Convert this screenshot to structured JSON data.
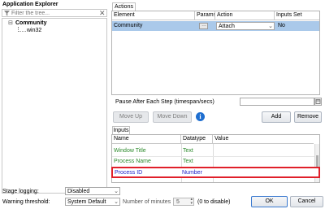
{
  "explorer": {
    "title": "Application Explorer",
    "filter_placeholder": "Filter the tree...",
    "tree_root": "Community",
    "tree_child": "win32",
    "tree_toggle": "⊟"
  },
  "actions": {
    "tab_label": "Actions",
    "columns": [
      "Element",
      "Params",
      "Action",
      "Inputs Set"
    ],
    "row": {
      "element": "Community",
      "action": "Attach",
      "inputs_set": "No"
    }
  },
  "pause": {
    "label": "Pause After Each Step (timespan/secs)",
    "value": ""
  },
  "buttons": {
    "move_up": "Move Up",
    "move_down": "Move Down",
    "add": "Add",
    "remove": "Remove",
    "ok": "OK",
    "cancel": "Cancel"
  },
  "inputs": {
    "tab_label": "Inputs",
    "columns": [
      "Name",
      "Datatype",
      "Value"
    ],
    "rows": [
      {
        "name": "Window Title",
        "datatype": "Text",
        "value": ""
      },
      {
        "name": "Process Name",
        "datatype": "Text",
        "value": ""
      },
      {
        "name": "Process ID",
        "datatype": "Number",
        "value": ""
      }
    ]
  },
  "footer": {
    "stage_logging_label": "Stage logging:",
    "stage_logging_value": "Disabled",
    "warning_label": "Warning threshold:",
    "warning_value": "System Default",
    "minutes_label": "Number of minutes",
    "minutes_value": "5",
    "disable_hint": "(0 to disable)"
  },
  "colors": {
    "selected_row": "#aac9ea",
    "green_text": "#2c8a2c",
    "blue_text": "#2020c8",
    "highlight_border": "#e0202a"
  }
}
